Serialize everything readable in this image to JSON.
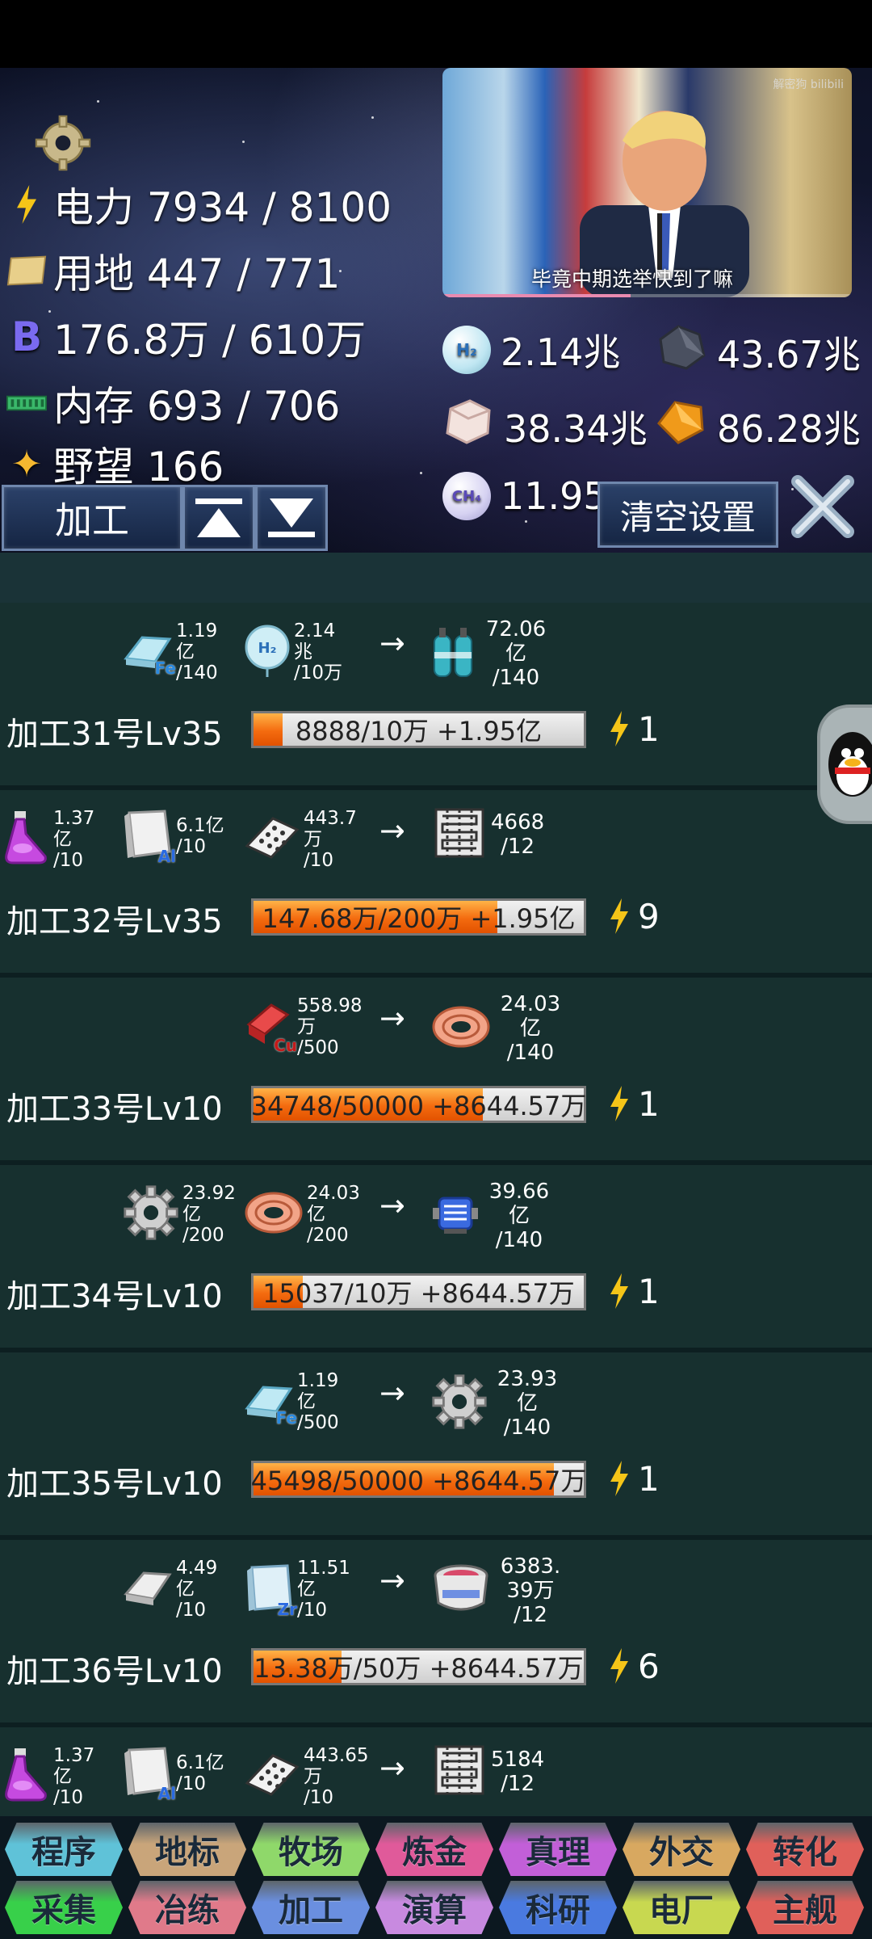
{
  "resources_left": [
    {
      "icon": "lightning-icon",
      "label": "电力 7934 / 8100"
    },
    {
      "icon": "land-map-icon",
      "label": "用地 447 / 771"
    },
    {
      "icon": "currency-b-icon",
      "label": "176.8万 / 610万"
    },
    {
      "icon": "memory-chip-icon",
      "label": "内存 693 / 706"
    },
    {
      "icon": "star-icon",
      "label": "野望 166"
    }
  ],
  "video": {
    "subtitle": "毕竟中期选举快到了嘛",
    "watermark": "解密狗 bilibili"
  },
  "resources_right": [
    {
      "icon": "hydrogen-icon",
      "icon_text": "H₂",
      "value": "2.14兆"
    },
    {
      "icon": "ore-icon",
      "value": "43.67兆"
    },
    {
      "icon": "salt-crystal-icon",
      "value": "38.34兆"
    },
    {
      "icon": "amber-gem-icon",
      "value": "86.28兆"
    },
    {
      "icon": "methane-icon",
      "icon_text": "CH₄",
      "value": "11.95"
    }
  ],
  "controls": {
    "category": "加工",
    "clear_settings": "清空设置"
  },
  "processors": [
    {
      "title": "加工31号Lv35",
      "bar_text": "8888/10万 +1.95亿",
      "progress": 0.0888,
      "power": "1",
      "inputs": [
        {
          "icon": "iron-ingot-icon",
          "tag": "Fe",
          "amount": "1.19亿",
          "need": "/140"
        },
        {
          "icon": "hydrogen-icon",
          "tag": "H₂",
          "amount": "2.14兆",
          "need": "/10万"
        }
      ],
      "output": {
        "icon": "gas-cylinders-icon",
        "amount": "72.06 亿",
        "need": "/140"
      }
    },
    {
      "title": "加工32号Lv35",
      "bar_text": "147.68万/200万 +1.95亿",
      "progress": 0.7384,
      "power": "9",
      "inputs": [
        {
          "icon": "potion-flask-icon",
          "tag": "",
          "amount": "1.37亿",
          "need": "/10"
        },
        {
          "icon": "aluminum-ingot-icon",
          "tag": "Al",
          "amount": "6.1亿",
          "need": "/10"
        },
        {
          "icon": "circuit-board-icon",
          "tag": "",
          "amount": "443.7 万",
          "need": "/10"
        }
      ],
      "output": {
        "icon": "chip-grid-icon",
        "amount": "4668",
        "need": "/12"
      }
    },
    {
      "title": "加工33号Lv10",
      "bar_text": "34748/50000 +8644.57万",
      "progress": 0.695,
      "power": "1",
      "inputs": [
        {
          "icon": "copper-ingot-icon",
          "tag": "Cu",
          "amount": "558.98 万",
          "need": "/500"
        }
      ],
      "output": {
        "icon": "copper-coil-icon",
        "amount": "24.03 亿",
        "need": "/140"
      }
    },
    {
      "title": "加工34号Lv10",
      "bar_text": "15037/10万 +8644.57万",
      "progress": 0.15,
      "power": "1",
      "inputs": [
        {
          "icon": "gear-icon",
          "tag": "",
          "amount": "23.92 亿",
          "need": "/200"
        },
        {
          "icon": "copper-coil-icon",
          "tag": "",
          "amount": "24.03 亿",
          "need": "/200"
        }
      ],
      "output": {
        "icon": "motor-icon",
        "amount": "39.66 亿",
        "need": "/140"
      }
    },
    {
      "title": "加工35号Lv10",
      "bar_text": "45498/50000 +8644.57万",
      "progress": 0.91,
      "power": "1",
      "inputs": [
        {
          "icon": "iron-ingot-icon",
          "tag": "Fe",
          "amount": "1.19亿",
          "need": "/500"
        }
      ],
      "output": {
        "icon": "gear-icon",
        "amount": "23.93 亿",
        "need": "/140"
      }
    },
    {
      "title": "加工36号Lv10",
      "bar_text": "13.38万/50万 +8644.57万",
      "progress": 0.2676,
      "power": "6",
      "inputs": [
        {
          "icon": "silver-ingot-icon",
          "tag": "",
          "amount": "4.49亿",
          "need": "/10"
        },
        {
          "icon": "zirconium-ingot-icon",
          "tag": "Zr",
          "amount": "11.51 亿",
          "need": "/10"
        }
      ],
      "output": {
        "icon": "reactor-pot-icon",
        "amount": "6383. 39万",
        "need": "/12"
      }
    },
    {
      "title": "",
      "bar_text": "",
      "progress": 0,
      "power": "",
      "inputs": [
        {
          "icon": "potion-flask-icon",
          "tag": "",
          "amount": "1.37亿",
          "need": "/10"
        },
        {
          "icon": "aluminum-ingot-icon",
          "tag": "Al",
          "amount": "6.1亿",
          "need": "/10"
        },
        {
          "icon": "circuit-board-icon",
          "tag": "",
          "amount": "443.65 万",
          "need": "/10"
        }
      ],
      "output": {
        "icon": "chip-grid-icon",
        "amount": "5184",
        "need": "/12"
      }
    }
  ],
  "tabs_row1": [
    {
      "label": "程序",
      "color": "#5fc2d8"
    },
    {
      "label": "地标",
      "color": "#c9a57a"
    },
    {
      "label": "牧场",
      "color": "#8fd86a"
    },
    {
      "label": "炼金",
      "color": "#e05a9a"
    },
    {
      "label": "真理",
      "color": "#c25fd8"
    },
    {
      "label": "外交",
      "color": "#d8a860"
    },
    {
      "label": "转化",
      "color": "#e0605a"
    }
  ],
  "tabs_row2": [
    {
      "label": "采集",
      "color": "#38d04a"
    },
    {
      "label": "冶练",
      "color": "#e07a8a"
    },
    {
      "label": "加工",
      "color": "#6a8fe0"
    },
    {
      "label": "演算",
      "color": "#c88ae0"
    },
    {
      "label": "科研",
      "color": "#4a7ae0"
    },
    {
      "label": "电厂",
      "color": "#c8d850"
    },
    {
      "label": "主舰",
      "color": "#e0605a"
    }
  ]
}
